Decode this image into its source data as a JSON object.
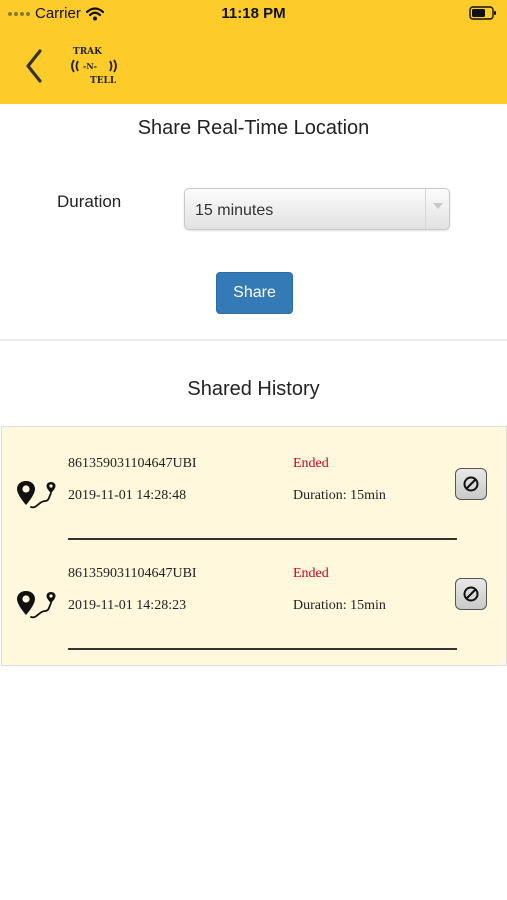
{
  "status_bar": {
    "carrier": "Carrier",
    "time": "11:18 PM"
  },
  "nav": {
    "logo_text": [
      "TRAK",
      "N",
      "TELL"
    ]
  },
  "share_section": {
    "title": "Share Real-Time Location",
    "duration_label": "Duration",
    "duration_value": "15 minutes",
    "share_label": "Share"
  },
  "history": {
    "title": "Shared History",
    "items": [
      {
        "device_id": "861359031104647UBI",
        "status": "Ended",
        "timestamp": "2019-11-01 14:28:48",
        "duration": "Duration: 15min"
      },
      {
        "device_id": "861359031104647UBI",
        "status": "Ended",
        "timestamp": "2019-11-01 14:28:23",
        "duration": "Duration: 15min"
      }
    ]
  },
  "colors": {
    "header": "#fdcc2a",
    "primary_button": "#337ab7",
    "status_ended": "#d0021b",
    "history_background": "#fff8dc"
  },
  "icons": {
    "back": "chevron-left-icon",
    "route": "route-pin-icon",
    "stop": "prohibited-icon"
  }
}
